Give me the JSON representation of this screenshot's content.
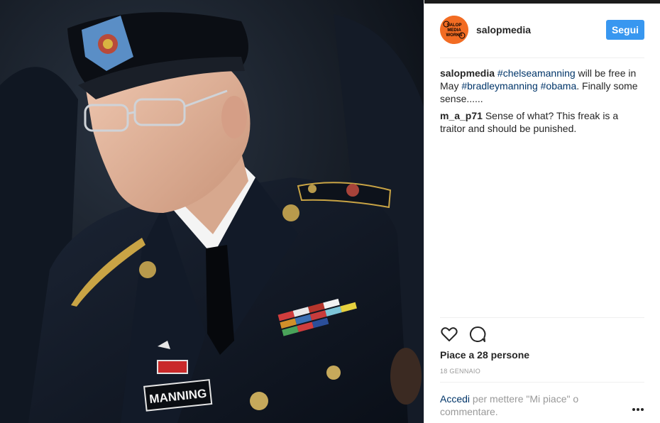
{
  "post": {
    "username": "salopmedia",
    "follow_label": "Segui",
    "avatar_text": [
      "SALOP",
      "MEDIA",
      "WORKS"
    ],
    "caption": {
      "user": "salopmedia",
      "parts": [
        {
          "type": "tag",
          "text": "#chelseamanning"
        },
        {
          "type": "text",
          "text": " will be free in May "
        },
        {
          "type": "tag",
          "text": "#bradleymanning"
        },
        {
          "type": "text",
          "text": " "
        },
        {
          "type": "tag",
          "text": "#obama"
        },
        {
          "type": "text",
          "text": ". Finally some sense......"
        }
      ]
    },
    "comment": {
      "user": "m_a_p71",
      "text": " Sense of what? This freak is a traitor and should be punished."
    },
    "likes_text": "Piace a 28 persone",
    "date_text": "18 GENNAIO",
    "login_link": "Accedi",
    "login_rest": " per mettere \"Mi piace\" o commentare.",
    "photo_nametag": "MANNING"
  },
  "icons": {
    "heart": "heart-icon",
    "comment": "comment-icon",
    "more": "more-options-icon"
  },
  "colors": {
    "follow_button": "#3897f0",
    "hashtag": "#003569",
    "avatar": "#f26c23",
    "muted": "#999999"
  }
}
